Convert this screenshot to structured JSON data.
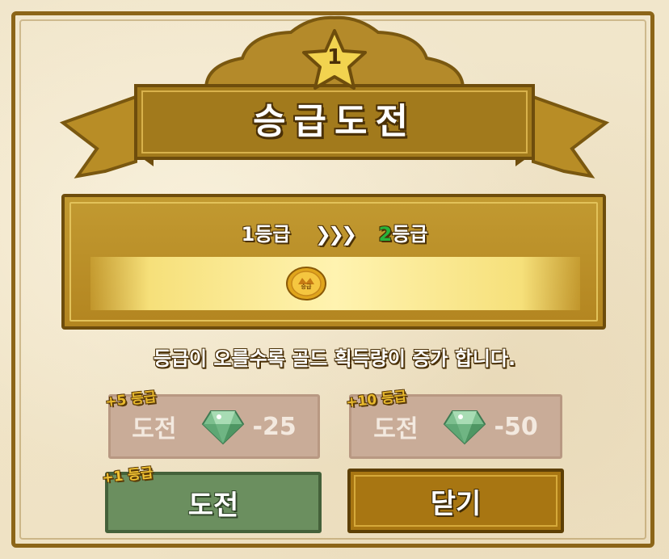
{
  "popup": {
    "rank_badge": "1",
    "title": "승급도전"
  },
  "grade": {
    "current": "1등급",
    "arrows": "❯❯❯",
    "next_number": "2",
    "next_suffix": "등급",
    "coin_label": "승급"
  },
  "info": "등급이 오를수록 골드 획득량이 증가 합니다.",
  "buttons": {
    "challenge5": {
      "badge": "+5 등급",
      "label": "도전",
      "cost": "-25",
      "enabled": false
    },
    "challenge10": {
      "badge": "+10 등급",
      "label": "도전",
      "cost": "-50",
      "enabled": false
    },
    "challenge1": {
      "badge": "+1 등급",
      "label": "도전",
      "enabled": true
    },
    "close": {
      "label": "닫기"
    }
  },
  "colors": {
    "frame": "#8c6518",
    "banner": "#a27a1c",
    "next_grade": "#27b33b",
    "challenge_green": "#6b8f5f",
    "close_brown": "#a87612"
  }
}
